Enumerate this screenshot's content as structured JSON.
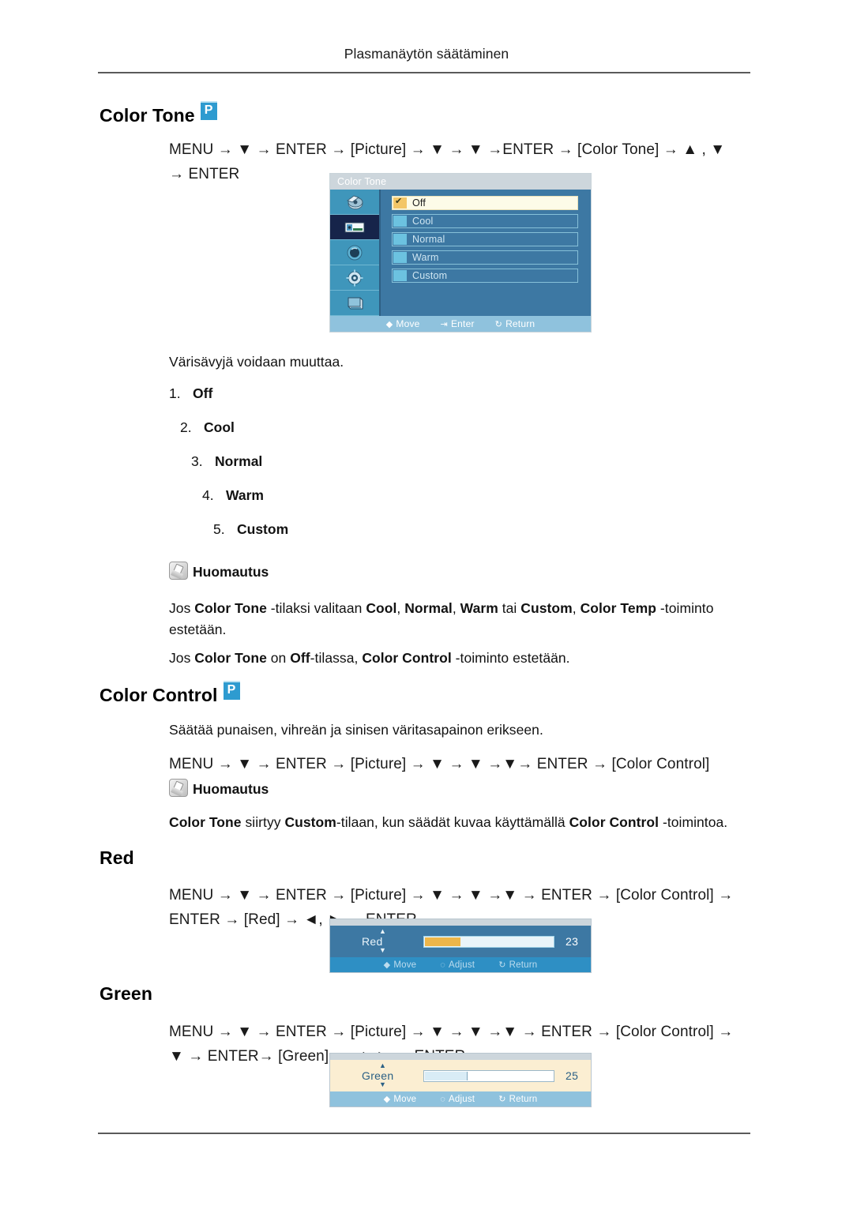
{
  "header": {
    "title": "Plasmanäytön säätäminen"
  },
  "sections": {
    "color_tone": {
      "heading": "Color Tone",
      "badge": "P",
      "path_line1": "MENU → ▼ → ENTER → [Picture] → ▼ → ▼ →ENTER → [Color Tone] → ▲ , ▼",
      "path_line2": "→ ENTER",
      "description": "Värisävyjä voidaan muuttaa.",
      "options": [
        {
          "num": "1.",
          "label": "Off"
        },
        {
          "num": "2.",
          "label": "Cool"
        },
        {
          "num": "3.",
          "label": "Normal"
        },
        {
          "num": "4.",
          "label": "Warm"
        },
        {
          "num": "5.",
          "label": "Custom"
        }
      ],
      "note_label": "Huomautus",
      "note1_line1": "Jos Color Tone -tilaksi valitaan Cool, Normal, Warm tai Custom, Color Temp -toiminto",
      "note1_line2": "estetään.",
      "note2": "Jos Color Tone on Off-tilassa, Color Control -toiminto estetään."
    },
    "color_control": {
      "heading": "Color Control",
      "badge": "P",
      "description": "Säätää punaisen, vihreän ja sinisen väritasapainon erikseen.",
      "path_line1": "MENU → ▼ → ENTER → [Picture] → ▼ → ▼ →▼→ ENTER → [Color Control]",
      "note_label": "Huomautus",
      "note1": "Color Tone siirtyy Custom-tilaan, kun säädät kuvaa käyttämällä Color Control -toimintoa."
    },
    "red": {
      "heading": "Red",
      "path_line1": "MENU → ▼ → ENTER → [Picture] → ▼ → ▼ →▼ → ENTER → [Color Control] →",
      "path_line2": "ENTER → [Red] → ◄, ► → ENTER"
    },
    "green": {
      "heading": "Green",
      "path_line1": "MENU → ▼ → ENTER → [Picture] → ▼ → ▼ →▼ → ENTER → [Color Control] →",
      "path_line2": "▼ → ENTER→ [Green] → ◄, ► → ENTER"
    }
  },
  "osd_color_tone": {
    "title": "Color Tone",
    "rows": [
      {
        "label": "Off",
        "selected": true
      },
      {
        "label": "Cool",
        "selected": false
      },
      {
        "label": "Normal",
        "selected": false
      },
      {
        "label": "Warm",
        "selected": false
      },
      {
        "label": "Custom",
        "selected": false
      }
    ],
    "footer": {
      "move": "Move",
      "enter": "Enter",
      "return": "Return"
    }
  },
  "osd_red": {
    "name": "Red",
    "value": "23",
    "fill_percent": 28,
    "footer": {
      "move": "Move",
      "adjust": "Adjust",
      "return": "Return"
    }
  },
  "osd_green": {
    "name": "Green",
    "value": "25",
    "fill_percent": 33,
    "footer": {
      "move": "Move",
      "adjust": "Adjust",
      "return": "Return"
    }
  },
  "colors": {
    "badge_blue": "#2e9bd0",
    "osd_blue": "#3d78a3",
    "osd_cream": "#fbeed2",
    "slider_orange": "#edb64a"
  }
}
